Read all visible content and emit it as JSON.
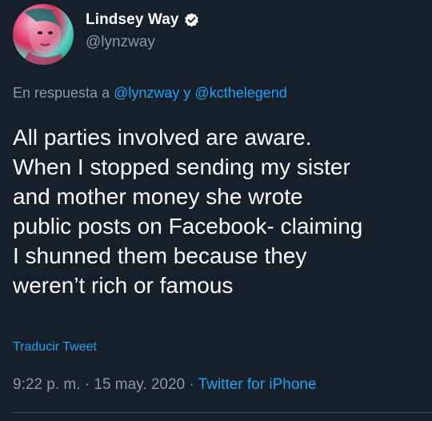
{
  "author": {
    "display_name": "Lindsey Way",
    "handle": "@lynzway",
    "verified": true,
    "avatar_icon": "profile-photo"
  },
  "reply": {
    "prefix": "En respuesta a",
    "mention_1": "@lynzway",
    "joiner": "y",
    "mention_2": "@kcthelegend"
  },
  "tweet": {
    "lines": [
      "All parties involved are aware.",
      "When I stopped sending my sister",
      "and mother money she wrote",
      "public posts on Facebook- claiming",
      "I shunned them because they",
      "weren’t rich or famous"
    ]
  },
  "translate_label": "Traducir Tweet",
  "meta": {
    "time": "9:22 p. m.",
    "separator": "·",
    "date": "15 may. 2020",
    "source": "Twitter for iPhone"
  },
  "colors": {
    "background": "#15202b",
    "accent": "#1da1f2",
    "muted": "#8899a6",
    "text": "#ffffff"
  }
}
